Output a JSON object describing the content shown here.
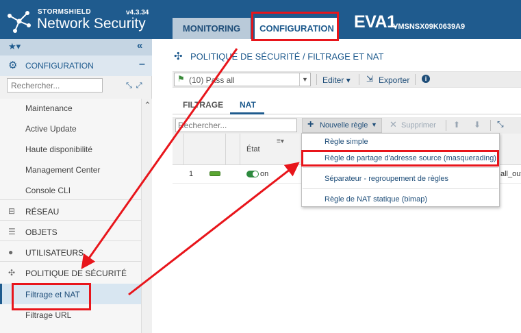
{
  "header": {
    "brand_top": "STORMSHIELD",
    "brand_name": "Network Security",
    "version": "v4.3.34",
    "tabs": [
      {
        "label": "MONITORING"
      },
      {
        "label": "CONFIGURATION"
      }
    ],
    "device_name": "EVA1",
    "device_serial": "VMSNSX09K0639A9"
  },
  "sidebar": {
    "section_label": "CONFIGURATION",
    "search_placeholder": "Rechercher...",
    "sub_items": [
      {
        "label": "Maintenance"
      },
      {
        "label": "Active Update"
      },
      {
        "label": "Haute disponibilité"
      },
      {
        "label": "Management Center"
      },
      {
        "label": "Console CLI"
      }
    ],
    "categories": [
      {
        "label": "RÉSEAU",
        "icon": "network-icon"
      },
      {
        "label": "OBJETS",
        "icon": "database-icon"
      },
      {
        "label": "UTILISATEURS",
        "icon": "user-icon"
      },
      {
        "label": "POLITIQUE DE SÉCURITÉ",
        "icon": "security-policy-icon"
      }
    ],
    "policy_items": [
      {
        "label": "Filtrage et NAT",
        "active": true
      },
      {
        "label": "Filtrage URL"
      }
    ]
  },
  "main": {
    "page_title": "POLITIQUE DE SÉCURITÉ / FILTRAGE ET NAT",
    "policy_select": "(10) Pass all",
    "edit_label": "Editer",
    "export_label": "Exporter",
    "subtabs": [
      {
        "label": "FILTRAGE"
      },
      {
        "label": "NAT"
      }
    ],
    "rule_search_placeholder": "Rechercher...",
    "new_rule_label": "Nouvelle règle",
    "delete_label": "Supprimer",
    "grid": {
      "state_header": "État",
      "rows": [
        {
          "num": "1",
          "state": "on",
          "trunc": "all_out"
        }
      ]
    },
    "new_rule_menu": [
      {
        "label": "Règle simple"
      },
      {
        "label": "Règle de partage d'adresse source (masquerading)"
      },
      {
        "label": "Séparateur - regroupement de règles"
      },
      {
        "label": "Règle de NAT statique (bimap)"
      }
    ]
  },
  "colors": {
    "header_blue": "#1f5b8e",
    "accent": "#1f4e79",
    "callout_red": "#e8151b",
    "status_green": "#2d8a3e"
  }
}
